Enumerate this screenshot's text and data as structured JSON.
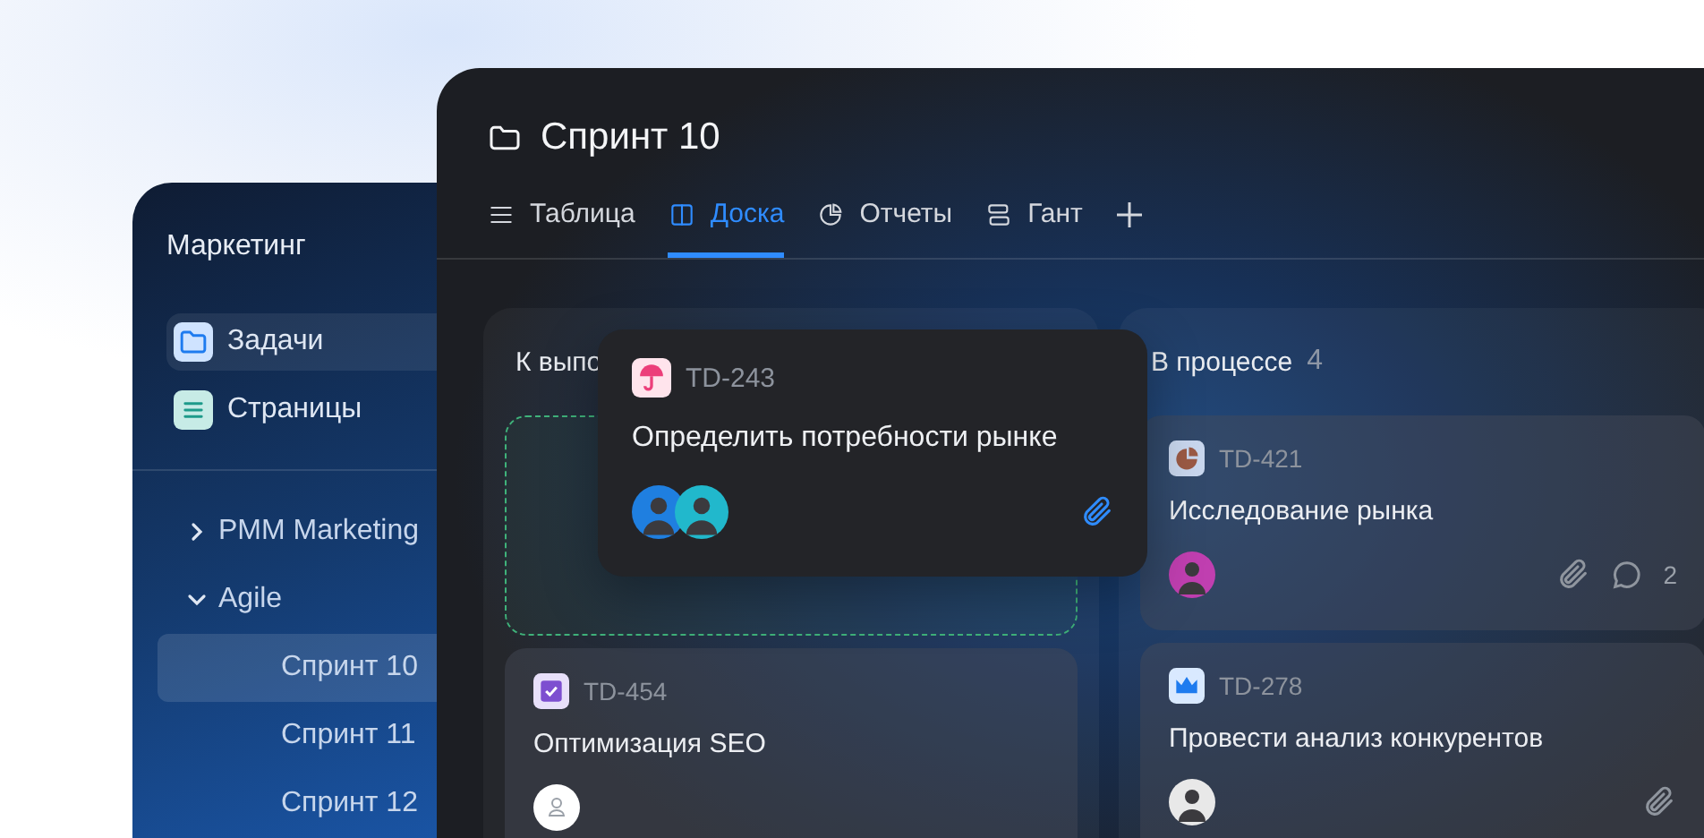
{
  "sidebar": {
    "title": "Маркетинг",
    "nav": [
      {
        "label": "Задачи",
        "selected": true
      },
      {
        "label": "Страницы",
        "selected": false
      }
    ],
    "tree": [
      {
        "label": "PMM Marketing",
        "expanded": false
      },
      {
        "label": "Agile",
        "expanded": true,
        "children": [
          {
            "label": "Спринт 10",
            "selected": true
          },
          {
            "label": "Спринт 11",
            "selected": false
          },
          {
            "label": "Спринт 12",
            "selected": false
          }
        ]
      }
    ]
  },
  "window": {
    "title": "Спринт 10"
  },
  "tabs": [
    {
      "label": "Таблица",
      "selected": false
    },
    {
      "label": "Доска",
      "selected": true
    },
    {
      "label": "Отчеты",
      "selected": false
    },
    {
      "label": "Гант",
      "selected": false
    }
  ],
  "columns": [
    {
      "title": "К выпо",
      "cards": [
        {
          "kind": "placeholder"
        },
        {
          "kind": "task",
          "id": "TD-454",
          "title": "Оптимизация SEO",
          "assignees": [
            {
              "kind": "empty"
            }
          ]
        }
      ]
    },
    {
      "title": "В процессе",
      "count": "4",
      "cards": [
        {
          "kind": "task",
          "id": "TD-421",
          "title": "Исследование рынка",
          "assignees": [
            {
              "kind": "person",
              "color": "#c03fb0"
            }
          ],
          "attachment": true,
          "comments": "2"
        },
        {
          "kind": "task",
          "id": "TD-278",
          "title": "Провести анализ конкурентов",
          "assignees": [
            {
              "kind": "person",
              "color": "#e8e8e8"
            }
          ],
          "attachment": true
        }
      ]
    }
  ],
  "dragged_card": {
    "id": "TD-243",
    "title": "Определить потребности рынке",
    "assignees": [
      {
        "kind": "person",
        "color": "#1f7fe0"
      },
      {
        "kind": "person",
        "color": "#21b8cc"
      }
    ],
    "attachment": true
  }
}
